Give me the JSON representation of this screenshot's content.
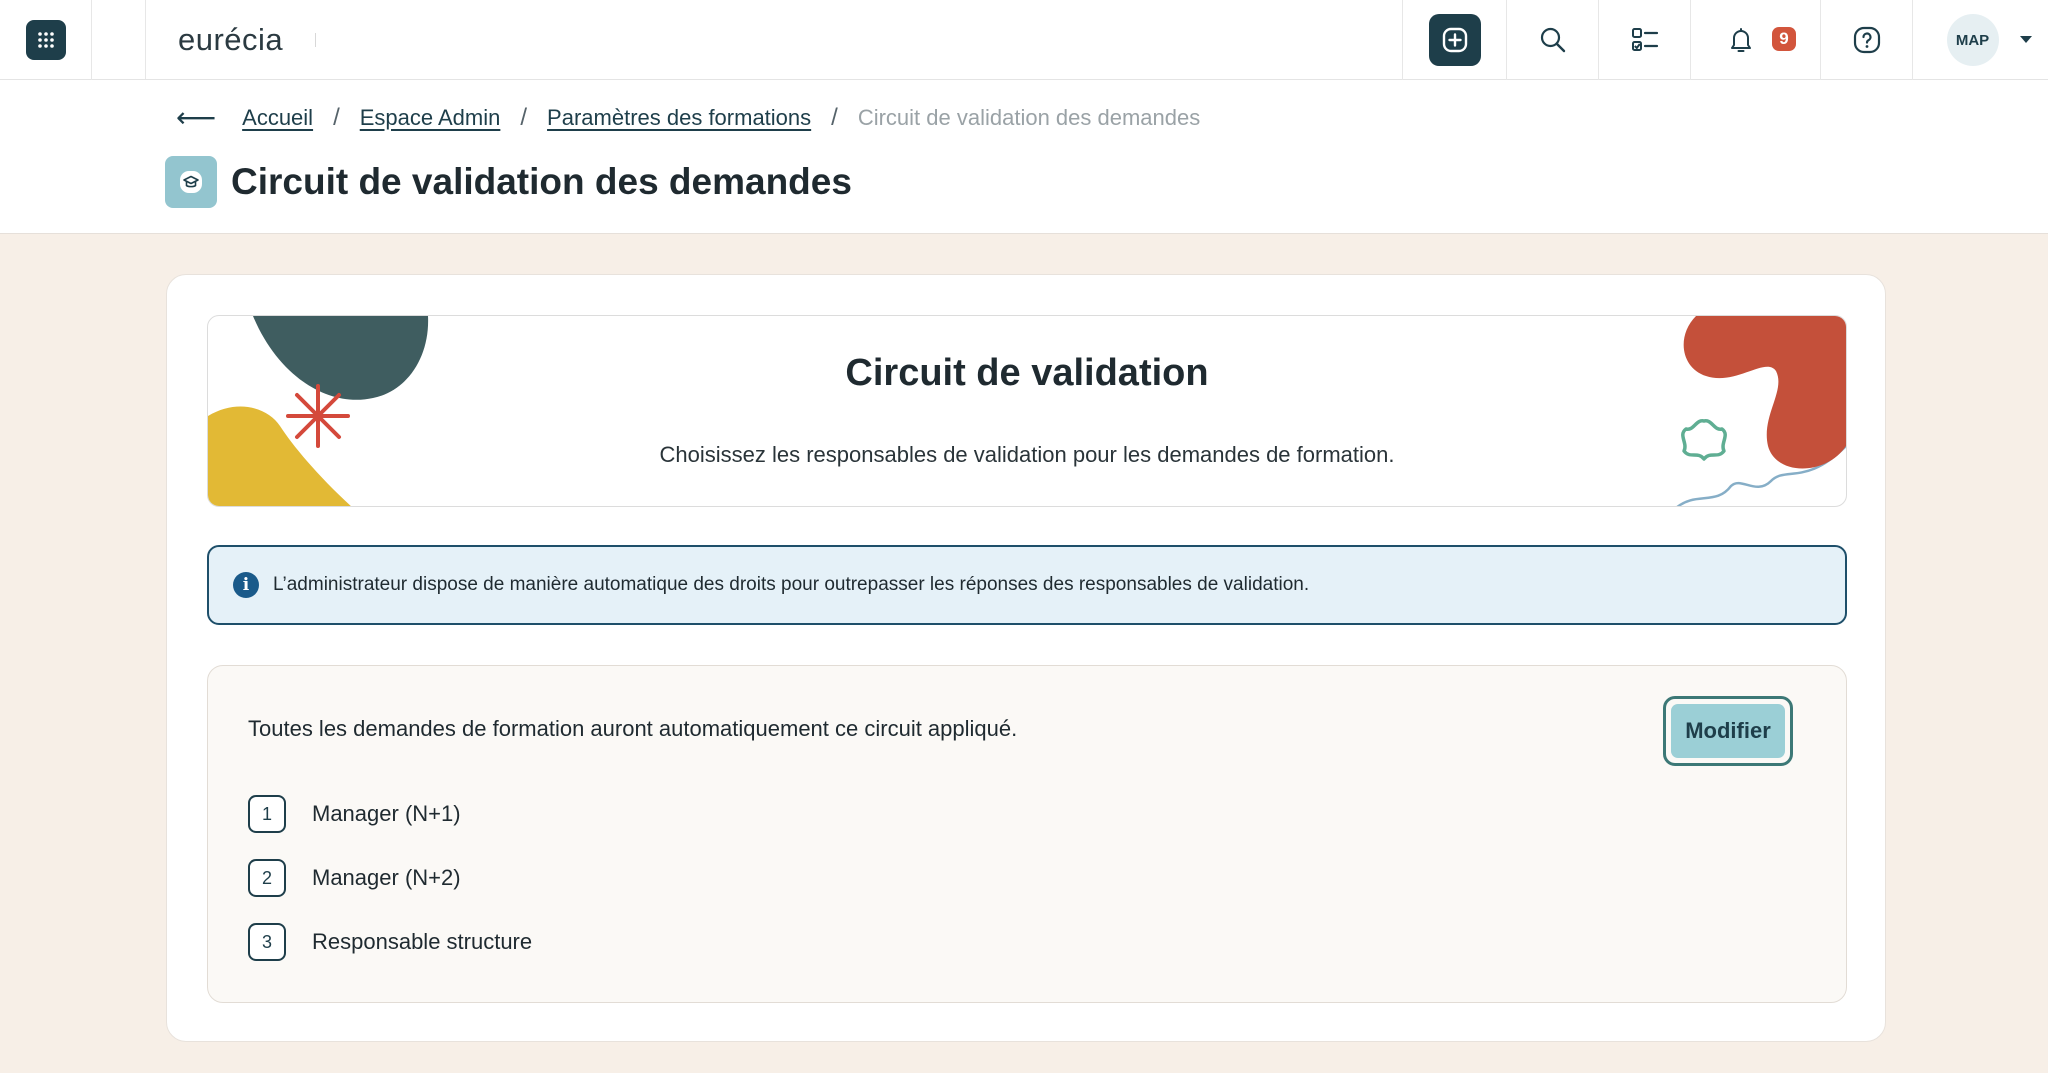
{
  "topbar": {
    "brand": "eurécia",
    "notification_count": "9",
    "user_initials": "MAP"
  },
  "breadcrumb": {
    "back_icon": "arrow-left-icon",
    "items": [
      "Accueil",
      "Espace Admin",
      "Paramètres des formations"
    ],
    "current": "Circuit de validation des demandes"
  },
  "page": {
    "title": "Circuit de validation des demandes",
    "icon": "graduation-cap-icon"
  },
  "hero": {
    "title": "Circuit de validation",
    "subtitle": "Choisissez les responsables de validation pour les demandes de formation."
  },
  "info": {
    "text": "L’administrateur dispose de manière automatique des droits pour outrepasser les réponses des responsables de validation."
  },
  "circuit": {
    "description": "Toutes les demandes de formation auront automatiquement ce circuit appliqué.",
    "modify_label": "Modifier",
    "steps": [
      {
        "number": "1",
        "label": "Manager (N+1)"
      },
      {
        "number": "2",
        "label": "Manager (N+2)"
      },
      {
        "number": "3",
        "label": "Responsable structure"
      }
    ]
  },
  "colors": {
    "primary_dark": "#1e3e4a",
    "accent_teal": "#9bcfd6",
    "badge_red": "#d2553c",
    "page_bg": "#f7efe7",
    "info_bg": "#e5f1f8"
  }
}
